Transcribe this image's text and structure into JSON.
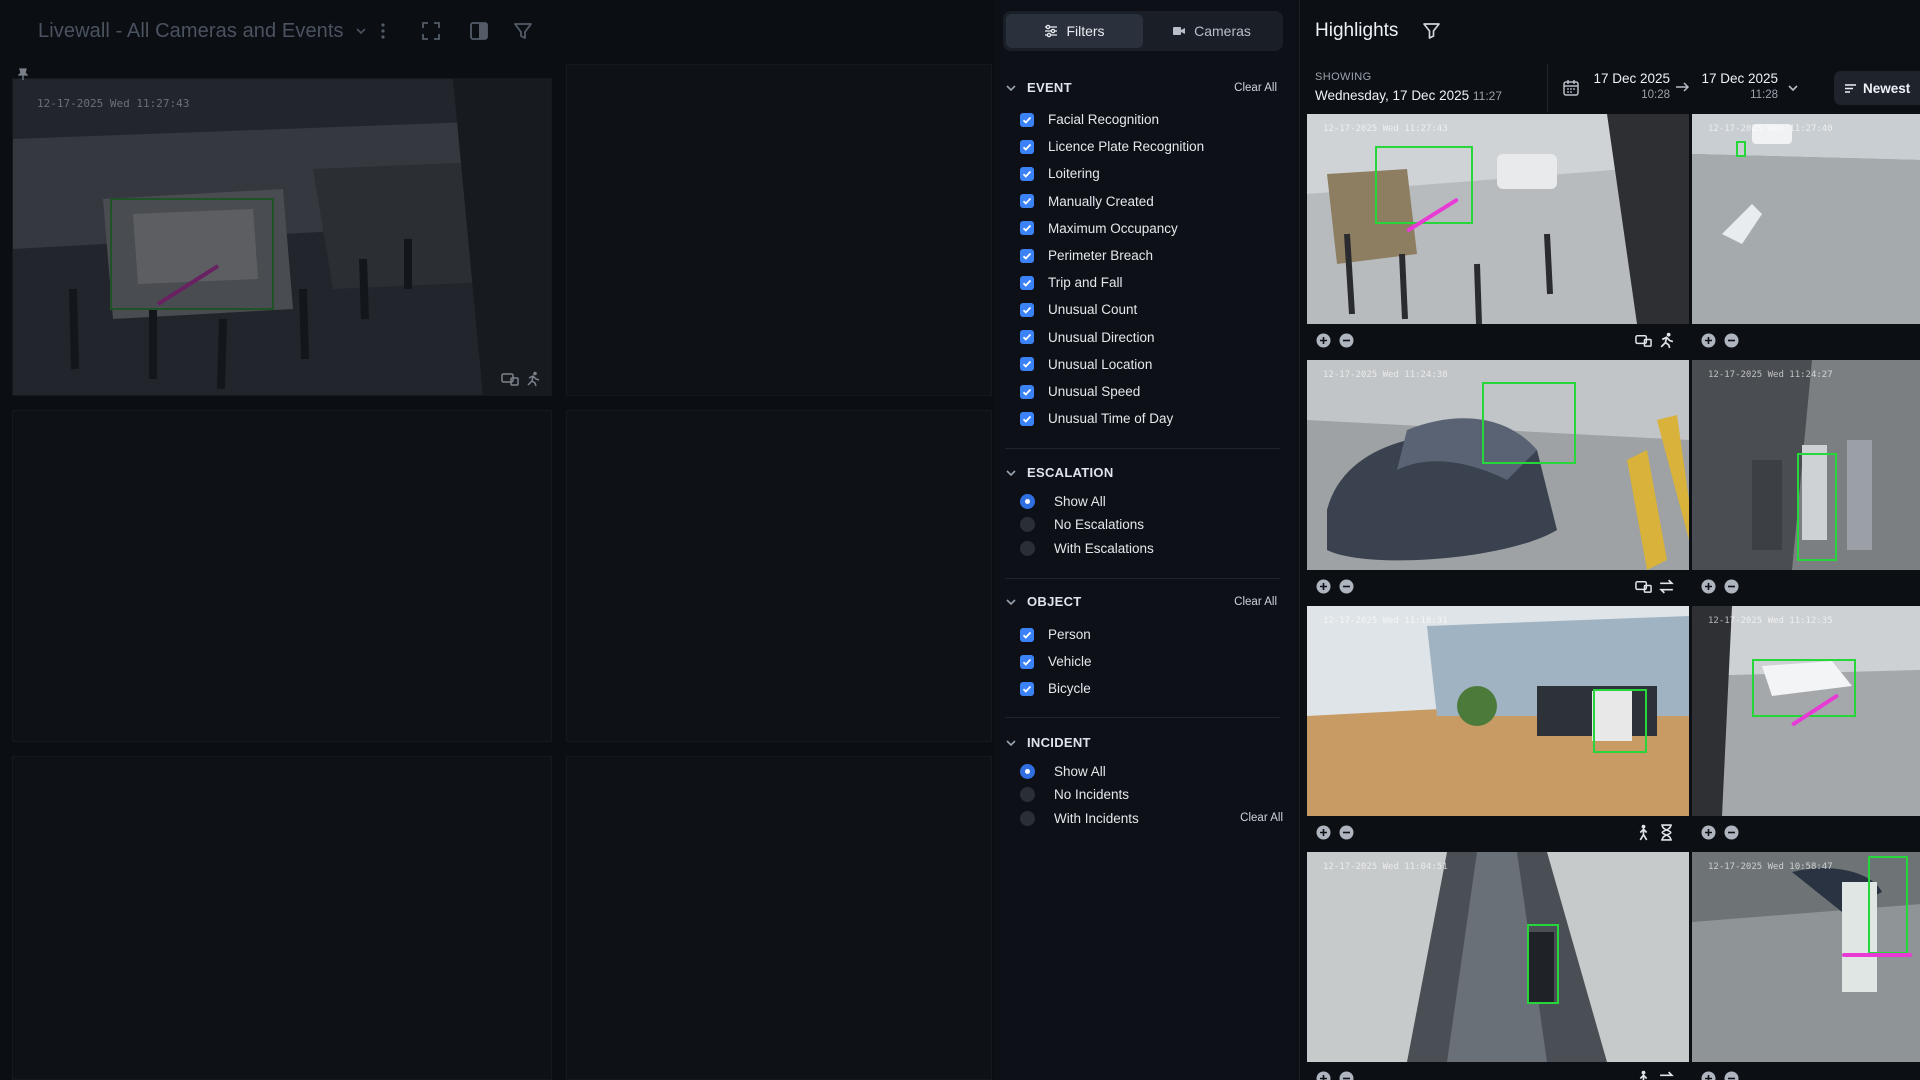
{
  "livewall": {
    "title": "Livewall - All Cameras and Events",
    "tile_timestamp": "12-17-2025 Wed 11:27:43"
  },
  "filters": {
    "tabs": [
      {
        "label": "Filters",
        "icon": "sliders-icon",
        "active": true
      },
      {
        "label": "Cameras",
        "icon": "camera-icon",
        "active": false
      }
    ],
    "event": {
      "title": "EVENT",
      "clear_label": "Clear All",
      "items": [
        {
          "label": "Facial Recognition",
          "checked": true
        },
        {
          "label": "Licence Plate Recognition",
          "checked": true
        },
        {
          "label": "Loitering",
          "checked": true
        },
        {
          "label": "Manually Created",
          "checked": true
        },
        {
          "label": "Maximum Occupancy",
          "checked": true
        },
        {
          "label": "Perimeter Breach",
          "checked": true
        },
        {
          "label": "Trip and Fall",
          "checked": true
        },
        {
          "label": "Unusual Count",
          "checked": true
        },
        {
          "label": "Unusual Direction",
          "checked": true
        },
        {
          "label": "Unusual Location",
          "checked": true
        },
        {
          "label": "Unusual Speed",
          "checked": true
        },
        {
          "label": "Unusual Time of Day",
          "checked": true
        }
      ]
    },
    "escalation": {
      "title": "ESCALATION",
      "options": [
        {
          "label": "Show All",
          "selected": true
        },
        {
          "label": "No Escalations",
          "selected": false
        },
        {
          "label": "With Escalations",
          "selected": false
        }
      ]
    },
    "object": {
      "title": "OBJECT",
      "clear_label": "Clear All",
      "items": [
        {
          "label": "Person",
          "checked": true
        },
        {
          "label": "Vehicle",
          "checked": true
        },
        {
          "label": "Bicycle",
          "checked": true
        }
      ]
    },
    "incident": {
      "title": "INCIDENT",
      "clear_label": "Clear All",
      "options": [
        {
          "label": "Show All",
          "selected": true
        },
        {
          "label": "No Incidents",
          "selected": false
        },
        {
          "label": "With Incidents",
          "selected": false
        }
      ]
    }
  },
  "highlights": {
    "title": "Highlights",
    "showing_label": "SHOWING",
    "showing_date": "Wednesday, 17 Dec 2025",
    "showing_time": "11:27",
    "range_start_date": "17 Dec 2025",
    "range_start_time": "10:28",
    "range_end_date": "17 Dec 2025",
    "range_end_time": "11:28",
    "sort_label": "Newest",
    "cards": [
      {
        "timestamp": "12-17-2025 Wed 11:27:43",
        "icons": [
          "vehicle-icon",
          "person-running-icon"
        ]
      },
      {
        "timestamp": "12-17-2025 Wed 11:27:40",
        "icons": []
      },
      {
        "timestamp": "12-17-2025 Wed 11:24:38",
        "icons": [
          "vehicle-icon",
          "swap-arrows-icon"
        ]
      },
      {
        "timestamp": "12-17-2025 Wed 11:24:27",
        "icons": []
      },
      {
        "timestamp": "12-17-2025 Wed 11:18:31",
        "icons": [
          "person-walking-icon",
          "hourglass-icon"
        ]
      },
      {
        "timestamp": "12-17-2025 Wed 11:12:35",
        "icons": []
      },
      {
        "timestamp": "12-17-2025 Wed 11:04:51",
        "icons": [
          "person-walking-icon",
          "swap-arrows-icon"
        ]
      },
      {
        "timestamp": "12-17-2025 Wed 10:58:47",
        "icons": []
      }
    ]
  },
  "colors": {
    "accent": "#3b82f6",
    "detection_box": "#27d63a",
    "motion_line": "#e83ad4"
  }
}
